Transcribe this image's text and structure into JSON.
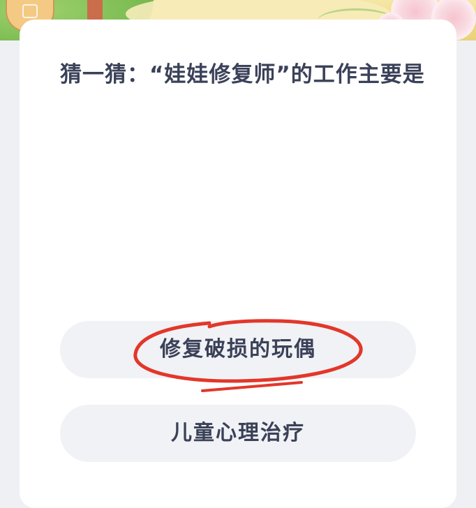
{
  "quiz": {
    "question": "猜一猜：“娃娃修复师”的工作主要是",
    "options": [
      {
        "label": "修复破损的玩偶",
        "annotated": true
      },
      {
        "label": "儿童心理治疗",
        "annotated": false
      }
    ]
  },
  "colors": {
    "text": "#3a4158",
    "option_bg": "#f1f2f5",
    "card_bg": "#ffffff",
    "page_bg": "#eef0f3",
    "annotation": "#e2372a"
  },
  "icons": {
    "banner": "cartoon-garden-illustration",
    "annotation": "hand-drawn-red-circle"
  }
}
